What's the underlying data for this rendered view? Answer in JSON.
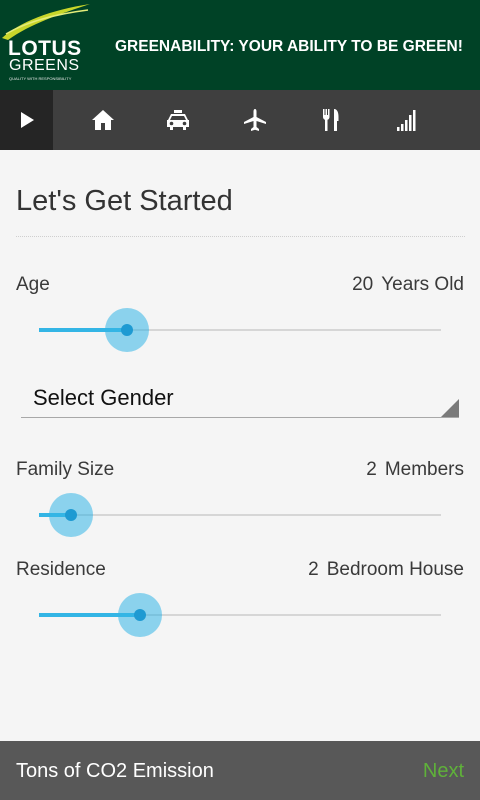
{
  "header": {
    "logo_title": "LOTUS",
    "logo_sub": "GREENS",
    "logo_tagline": "QUALITY WITH RESPONSIBILITY",
    "tagline": "GREENABILITY: YOUR ABILITY TO BE GREEN!"
  },
  "tabs": [
    {
      "icon": "play-icon",
      "active": true
    },
    {
      "icon": "home-icon",
      "active": false
    },
    {
      "icon": "car-icon",
      "active": false
    },
    {
      "icon": "airplane-icon",
      "active": false
    },
    {
      "icon": "fork-knife-icon",
      "active": false
    },
    {
      "icon": "signal-bars-icon",
      "active": false
    }
  ],
  "form": {
    "title": "Let's Get Started",
    "age": {
      "label": "Age",
      "value": "20",
      "unit": "Years Old",
      "fraction": 0.22
    },
    "gender": {
      "selected": "Select Gender"
    },
    "family": {
      "label": "Family Size",
      "value": "2",
      "unit": "Members",
      "fraction": 0.08
    },
    "residence": {
      "label": "Residence",
      "value": "2",
      "unit": "Bedroom House",
      "fraction": 0.25
    }
  },
  "footer": {
    "emission_label": "Tons of CO2 Emission",
    "next_label": "Next"
  },
  "colors": {
    "header_bg": "#004226",
    "tabbar_bg": "#3f3f3f",
    "accent": "#33b5e5",
    "next_green": "#5fb13a",
    "footer_bg": "#585858"
  }
}
